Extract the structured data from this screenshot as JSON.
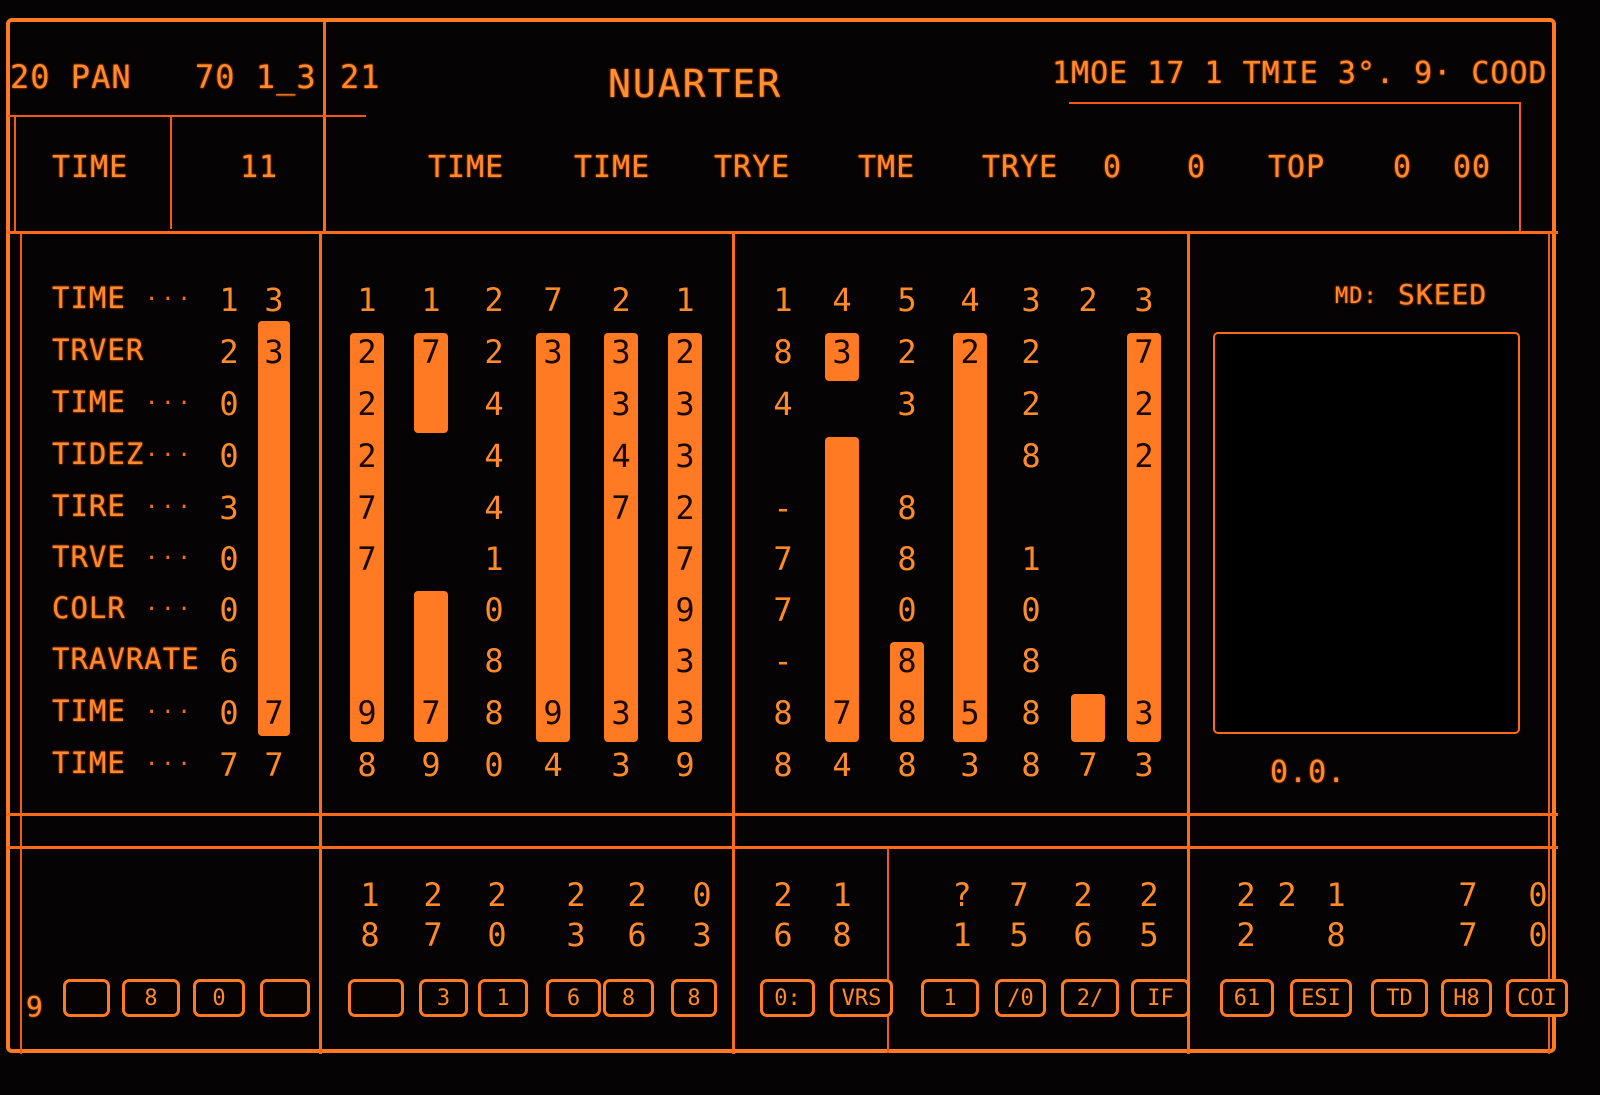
{
  "header": {
    "left_label": "20 PAN",
    "left_value": "70 1_3",
    "channel": "21",
    "title": "NUARTER",
    "status_readout": "1MOE 17 1 TMIE  3°. 9· COOD",
    "row2_label": "TIME",
    "row2_value": "11",
    "row2_fields": [
      "TIME",
      "TIME",
      "TRYE",
      "TME",
      "TRYE",
      "0",
      "0",
      "TOP",
      "0",
      "00"
    ]
  },
  "left_panel": {
    "rows": [
      {
        "label": "TIME",
        "value": "1",
        "bar_digit": "3"
      },
      {
        "label": "TRVER",
        "value": "2",
        "bar_digit": "3"
      },
      {
        "label": "TIME",
        "value": "0",
        "bar_digit": ""
      },
      {
        "label": "TIDEZ",
        "value": "0",
        "bar_digit": ""
      },
      {
        "label": "TIRE",
        "value": "3",
        "bar_digit": ""
      },
      {
        "label": "TRVE",
        "value": "0",
        "bar_digit": ""
      },
      {
        "label": "COLR",
        "value": "0",
        "bar_digit": ""
      },
      {
        "label": "TRAVRATE",
        "value": "6",
        "bar_digit": ""
      },
      {
        "label": "TIME",
        "value": "0",
        "bar_digit": "7"
      },
      {
        "label": "TIME",
        "value": "7",
        "bar_digit": "7"
      }
    ],
    "dots": "···"
  },
  "channels_a": [
    {
      "top": "1",
      "bottom": "8",
      "digits": [
        "2",
        "2",
        "2",
        "7",
        "7",
        "",
        "",
        "9"
      ],
      "level": [
        1,
        8
      ]
    },
    {
      "top": "1",
      "bottom": "9",
      "digits": [
        "7",
        "",
        "",
        "",
        "",
        "",
        "",
        "7"
      ],
      "level": [
        1,
        2
      ],
      "level2": [
        6,
        8
      ]
    },
    {
      "top": "2",
      "bottom": "0",
      "digits": [
        "2",
        "4",
        "4",
        "4",
        "1",
        "0",
        "8",
        "8"
      ],
      "level": null
    },
    {
      "top": "7",
      "bottom": "4",
      "digits": [
        "3",
        "",
        "",
        "",
        "",
        "",
        "",
        "9"
      ],
      "level": [
        1,
        8
      ]
    },
    {
      "top": "2",
      "bottom": "3",
      "digits": [
        "3",
        "3",
        "4",
        "7",
        "",
        "",
        "",
        "3"
      ],
      "level": [
        1,
        8
      ]
    },
    {
      "top": "1",
      "bottom": "9",
      "digits": [
        "2",
        "3",
        "3",
        "2",
        "7",
        "9",
        "3",
        "3"
      ],
      "level": [
        1,
        8
      ]
    }
  ],
  "channels_b": [
    {
      "top": "1",
      "bottom": "8",
      "digits": [
        "8",
        "4",
        "",
        "-",
        "7",
        "7",
        "-",
        "8"
      ],
      "level": null
    },
    {
      "top": "4",
      "bottom": "4",
      "digits": [
        "3",
        "",
        "",
        "",
        "",
        "",
        "",
        "7"
      ],
      "level": [
        1,
        1
      ],
      "level2": [
        3,
        8
      ]
    },
    {
      "top": "5",
      "bottom": "8",
      "digits": [
        "2",
        "3",
        "",
        "8",
        "8",
        "0",
        "8",
        "8"
      ],
      "level": [
        7,
        8
      ]
    },
    {
      "top": "4",
      "bottom": "3",
      "digits": [
        "2",
        "",
        "",
        "",
        "",
        "",
        "",
        "5"
      ],
      "level": [
        1,
        8
      ]
    },
    {
      "top": "3",
      "bottom": "8",
      "digits": [
        "2",
        "2",
        "8",
        "",
        "1",
        "0",
        "8",
        "8"
      ],
      "level": null
    },
    {
      "top": "2",
      "bottom": "7",
      "digits": [
        "",
        "",
        "",
        "",
        "",
        "",
        "",
        ""
      ],
      "level": [
        8,
        8
      ]
    },
    {
      "top": "3",
      "bottom": "3",
      "digits": [
        "7",
        "2",
        "2",
        "",
        "",
        "",
        "",
        "3"
      ],
      "level": [
        1,
        8
      ]
    }
  ],
  "monitor": {
    "mode_label": "MD:",
    "mode_value": "SKEED",
    "readout": "0.0."
  },
  "bottom": {
    "left_index": "9",
    "left_buttons": [
      "",
      "8",
      "0",
      ""
    ],
    "group_a_pairs": [
      [
        "1",
        "8"
      ],
      [
        "2",
        "7"
      ],
      [
        "2",
        "0"
      ],
      [
        "2",
        "3"
      ],
      [
        "2",
        "6"
      ],
      [
        "0",
        "3"
      ]
    ],
    "group_a_buttons": [
      "",
      "3",
      "1",
      "6",
      "8",
      "8"
    ],
    "group_b_pairs": [
      [
        "2",
        "6"
      ],
      [
        "1",
        "8"
      ]
    ],
    "group_b_buttons": [
      "0:",
      "VRS"
    ],
    "group_c_pairs": [
      [
        "?",
        "1"
      ],
      [
        "7",
        "5"
      ],
      [
        "2",
        "6"
      ],
      [
        "2",
        "5"
      ]
    ],
    "group_c_buttons": [
      "1",
      "/0",
      "2/",
      "IF"
    ],
    "group_d_pairs": [
      [
        "2",
        "2"
      ],
      [
        "2",
        ""
      ],
      [
        "1",
        "8"
      ],
      [
        "7",
        "7"
      ],
      [
        "0",
        "0"
      ]
    ],
    "group_d_buttons": [
      "61",
      "ESI",
      "TD",
      "H8",
      "COI"
    ]
  },
  "colors": {
    "accent": "#ff7a22",
    "line": "#ff6a1a",
    "background": "#050303",
    "bar_text": "#1a0800"
  }
}
